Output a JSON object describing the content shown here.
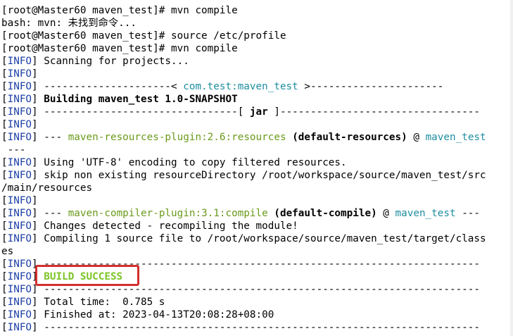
{
  "terminal": {
    "lines": [
      [
        {
          "t": "[root@Master60 maven_test]# mvn compile",
          "c": ""
        }
      ],
      [
        {
          "t": "bash: mvn: 未找到命令...",
          "c": ""
        }
      ],
      [
        {
          "t": "[root@Master60 maven_test]# source /etc/profile",
          "c": ""
        }
      ],
      [
        {
          "t": "[root@Master60 maven_test]# mvn compile",
          "c": ""
        }
      ],
      [
        {
          "t": "[",
          "c": ""
        },
        {
          "t": "INFO",
          "c": "blue"
        },
        {
          "t": "] Scanning for projects...",
          "c": ""
        }
      ],
      [
        {
          "t": "[",
          "c": ""
        },
        {
          "t": "INFO",
          "c": "blue"
        },
        {
          "t": "]",
          "c": ""
        }
      ],
      [
        {
          "t": "[",
          "c": ""
        },
        {
          "t": "INFO",
          "c": "blue"
        },
        {
          "t": "] ---------------------< ",
          "c": ""
        },
        {
          "t": "com.test:maven_test",
          "c": "cyan"
        },
        {
          "t": " >----------------------",
          "c": ""
        }
      ],
      [
        {
          "t": "[",
          "c": ""
        },
        {
          "t": "INFO",
          "c": "blue"
        },
        {
          "t": "] ",
          "c": ""
        },
        {
          "t": "Building maven_test 1.0-SNAPSHOT",
          "c": "bold"
        }
      ],
      [
        {
          "t": "[",
          "c": ""
        },
        {
          "t": "INFO",
          "c": "blue"
        },
        {
          "t": "] --------------------------------[ ",
          "c": ""
        },
        {
          "t": "jar",
          "c": "bold"
        },
        {
          "t": " ]---------------------------------",
          "c": ""
        }
      ],
      [
        {
          "t": "[",
          "c": ""
        },
        {
          "t": "INFO",
          "c": "blue"
        },
        {
          "t": "]",
          "c": ""
        }
      ],
      [
        {
          "t": "[",
          "c": ""
        },
        {
          "t": "INFO",
          "c": "blue"
        },
        {
          "t": "] --- ",
          "c": ""
        },
        {
          "t": "maven-resources-plugin:2.6:resources",
          "c": "green"
        },
        {
          "t": " ",
          "c": ""
        },
        {
          "t": "(default-resources)",
          "c": "bold"
        },
        {
          "t": " @ ",
          "c": ""
        },
        {
          "t": "maven_test",
          "c": "cyan"
        }
      ],
      [
        {
          "t": " ---",
          "c": ""
        }
      ],
      [
        {
          "t": "[",
          "c": ""
        },
        {
          "t": "INFO",
          "c": "blue"
        },
        {
          "t": "] Using 'UTF-8' encoding to copy filtered resources.",
          "c": ""
        }
      ],
      [
        {
          "t": "[",
          "c": ""
        },
        {
          "t": "INFO",
          "c": "blue"
        },
        {
          "t": "] skip non existing resourceDirectory /root/workspace/source/maven_test/src",
          "c": ""
        }
      ],
      [
        {
          "t": "/main/resources",
          "c": ""
        }
      ],
      [
        {
          "t": "[",
          "c": ""
        },
        {
          "t": "INFO",
          "c": "blue"
        },
        {
          "t": "]",
          "c": ""
        }
      ],
      [
        {
          "t": "[",
          "c": ""
        },
        {
          "t": "INFO",
          "c": "blue"
        },
        {
          "t": "] --- ",
          "c": ""
        },
        {
          "t": "maven-compiler-plugin:3.1:compile",
          "c": "green"
        },
        {
          "t": " ",
          "c": ""
        },
        {
          "t": "(default-compile)",
          "c": "bold"
        },
        {
          "t": " @ ",
          "c": ""
        },
        {
          "t": "maven_test",
          "c": "cyan"
        },
        {
          "t": " ---",
          "c": ""
        }
      ],
      [
        {
          "t": "[",
          "c": ""
        },
        {
          "t": "INFO",
          "c": "blue"
        },
        {
          "t": "] Changes detected - recompiling the module!",
          "c": ""
        }
      ],
      [
        {
          "t": "[",
          "c": ""
        },
        {
          "t": "INFO",
          "c": "blue"
        },
        {
          "t": "] Compiling 1 source file to /root/workspace/source/maven_test/target/class",
          "c": ""
        }
      ],
      [
        {
          "t": "es",
          "c": ""
        }
      ],
      [
        {
          "t": "[",
          "c": ""
        },
        {
          "t": "INFO",
          "c": "blue"
        },
        {
          "t": "] ------------------------------------------------------------------------",
          "c": ""
        }
      ],
      [
        {
          "t": "[",
          "c": ""
        },
        {
          "t": "INFO",
          "c": "blue"
        },
        {
          "t": "] ",
          "c": ""
        },
        {
          "t": "BUILD SUCCESS",
          "c": "lime"
        }
      ],
      [
        {
          "t": "[",
          "c": ""
        },
        {
          "t": "INFO",
          "c": "blue"
        },
        {
          "t": "] ------------------------------------------------------------------------",
          "c": ""
        }
      ],
      [
        {
          "t": "[",
          "c": ""
        },
        {
          "t": "INFO",
          "c": "blue"
        },
        {
          "t": "] Total time:  0.785 s",
          "c": ""
        }
      ],
      [
        {
          "t": "[",
          "c": ""
        },
        {
          "t": "INFO",
          "c": "blue"
        },
        {
          "t": "] Finished at: 2023-04-13T20:08:28+08:00",
          "c": ""
        }
      ],
      [
        {
          "t": "[",
          "c": ""
        },
        {
          "t": "INFO",
          "c": "blue"
        },
        {
          "t": "] ------------------------------------------------------------------------",
          "c": ""
        }
      ]
    ]
  },
  "colors": {
    "background": "#ffffff",
    "text": "#000000",
    "info_tag": "#1d3fa6",
    "artifact": "#1e8fa0",
    "plugin": "#6a9a1a",
    "success": "#7cc427",
    "highlight_border": "#d32f2f"
  }
}
